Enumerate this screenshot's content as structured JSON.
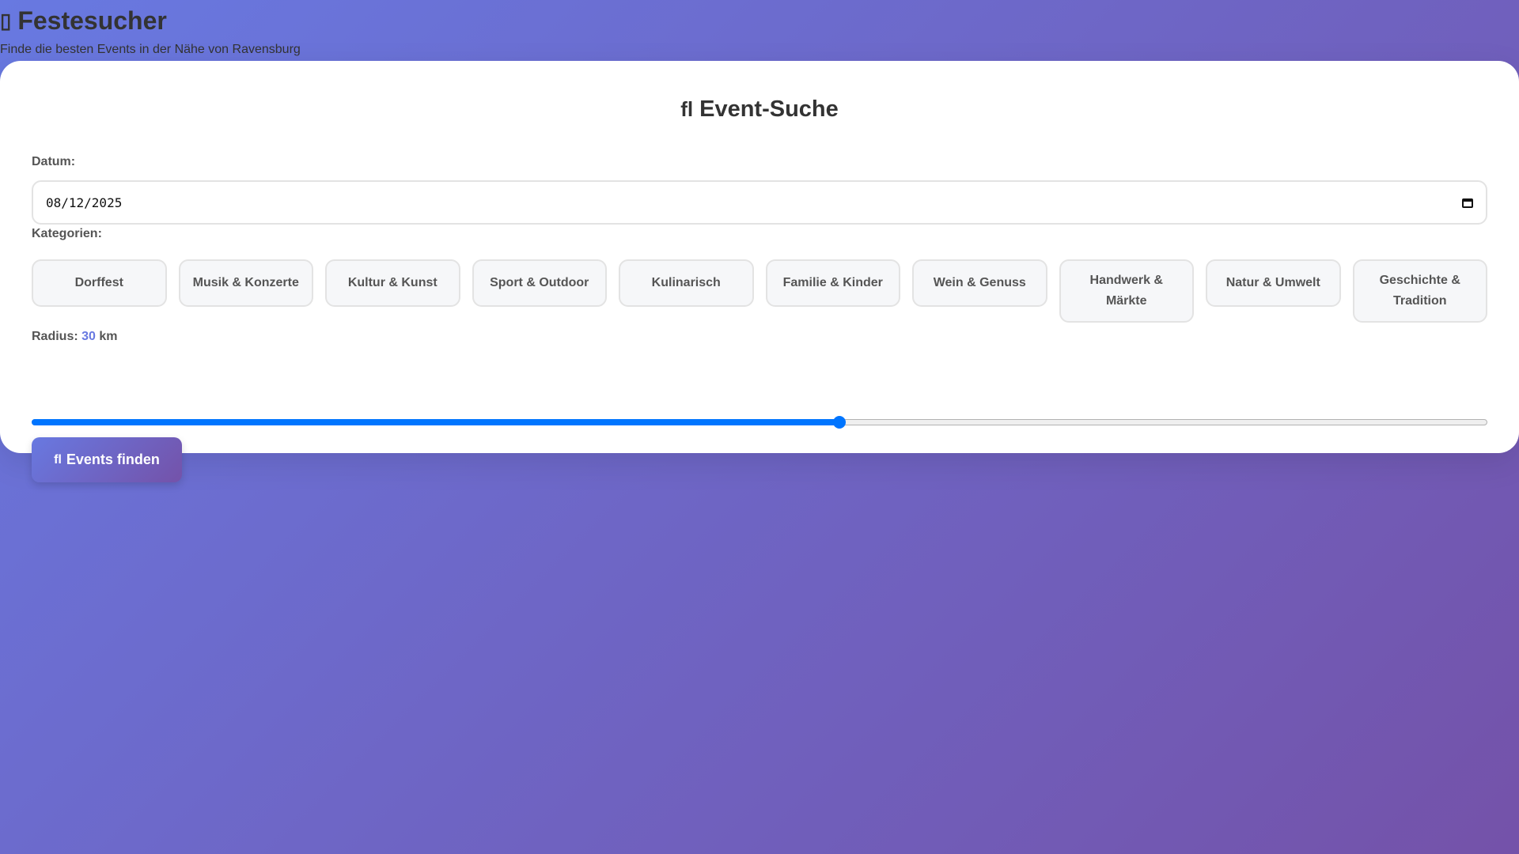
{
  "header": {
    "icon": "party-icon",
    "title": "Festesucher",
    "subtitle": "Finde die besten Events in der Nähe von Ravensburg"
  },
  "search": {
    "title_icon": "search-icon",
    "title": "Event-Suche",
    "date_label": "Datum:",
    "date_value": "08/12/2025",
    "categories_label": "Kategorien:",
    "categories": [
      "Dorffest",
      "Musik & Konzerte",
      "Kultur & Kunst",
      "Sport & Outdoor",
      "Kulinarisch",
      "Familie & Kinder",
      "Wein & Genuss",
      "Handwerk & Märkte",
      "Natur & Umwelt",
      "Geschichte & Tradition"
    ],
    "radius_label": "Radius:",
    "radius_value": "30",
    "radius_unit": "km",
    "radius_fraction": 0.555,
    "submit_icon": "search-icon",
    "submit_label": "Events finden"
  },
  "colors": {
    "gradient_start": "#6879e1",
    "gradient_end": "#7452a9",
    "accent": "#6879e1",
    "slider": "#0075ff"
  }
}
